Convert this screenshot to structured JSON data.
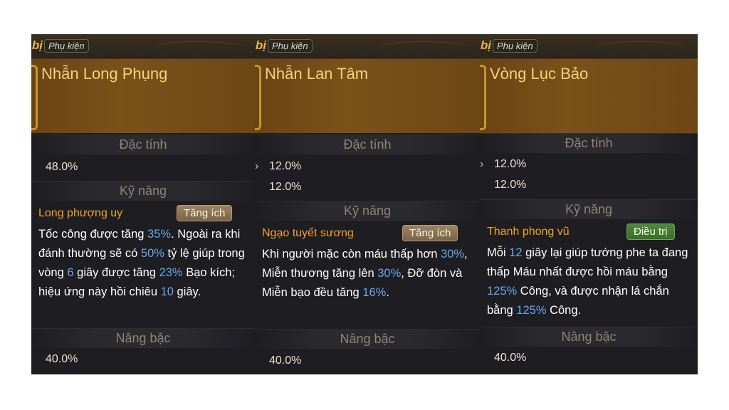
{
  "panels": [
    {
      "cut_title": "bị",
      "tag": "Phụ kiện",
      "name": "Nhẫn Long Phụng",
      "traits_label": "Đặc tính",
      "stats": [
        "48.0%"
      ],
      "skills_label": "Kỹ năng",
      "skill_name": "Long phượng uy",
      "skill_badge": "Tăng ích",
      "desc": [
        {
          "t": "Tốc công được tăng "
        },
        {
          "t": "35%",
          "hl": true
        },
        {
          "t": ". Ngoài ra khi đánh thường sẽ có "
        },
        {
          "t": "50%",
          "hl": true
        },
        {
          "t": " tỷ lệ giúp trong vòng "
        },
        {
          "t": "6",
          "hl": true
        },
        {
          "t": " giây được tăng "
        },
        {
          "t": "23%",
          "hl": true
        },
        {
          "t": " Bạo kích; hiệu ứng này hồi chiêu "
        },
        {
          "t": "10",
          "hl": true
        },
        {
          "t": " giây."
        }
      ],
      "upgrade_label": "Nâng bậc",
      "upgrade_value": "40.0%"
    },
    {
      "cut_title": "bị",
      "tag": "Phụ kiện",
      "name": "Nhẫn Lan Tâm",
      "traits_label": "Đặc tính",
      "stats": [
        "12.0%",
        "12.0%"
      ],
      "skills_label": "Kỹ năng",
      "skill_name": "Ngạo tuyết sương",
      "skill_badge": "Tăng ích",
      "desc": [
        {
          "t": "Khi người mặc còn máu thấp hơn "
        },
        {
          "t": "30%",
          "hl": true
        },
        {
          "t": ", Miễn thương tăng lên "
        },
        {
          "t": "30%",
          "hl": true
        },
        {
          "t": ", Đỡ đòn và Miễn bạo đều tăng "
        },
        {
          "t": "16%",
          "hl": true
        },
        {
          "t": "."
        }
      ],
      "upgrade_label": "Nâng bậc",
      "upgrade_value": "40.0%"
    },
    {
      "cut_title": "bị",
      "tag": "Phụ kiện",
      "name": "Vòng Lục Bảo",
      "traits_label": "Đặc tính",
      "stats": [
        "12.0%",
        "12.0%"
      ],
      "skills_label": "Kỹ năng",
      "skill_name": "Thanh phong vũ",
      "skill_badge": "Điều trị",
      "desc": [
        {
          "t": "Mỗi "
        },
        {
          "t": "12",
          "hl": true
        },
        {
          "t": " giây lại giúp tướng phe ta đang thấp Máu nhất được hồi máu bằng "
        },
        {
          "t": "125%",
          "hl": true
        },
        {
          "t": " Công, và được nhận lá chắn bằng "
        },
        {
          "t": "125%",
          "hl": true
        },
        {
          "t": " Công."
        }
      ],
      "upgrade_label": "Nâng bậc",
      "upgrade_value": "40.0%"
    }
  ]
}
